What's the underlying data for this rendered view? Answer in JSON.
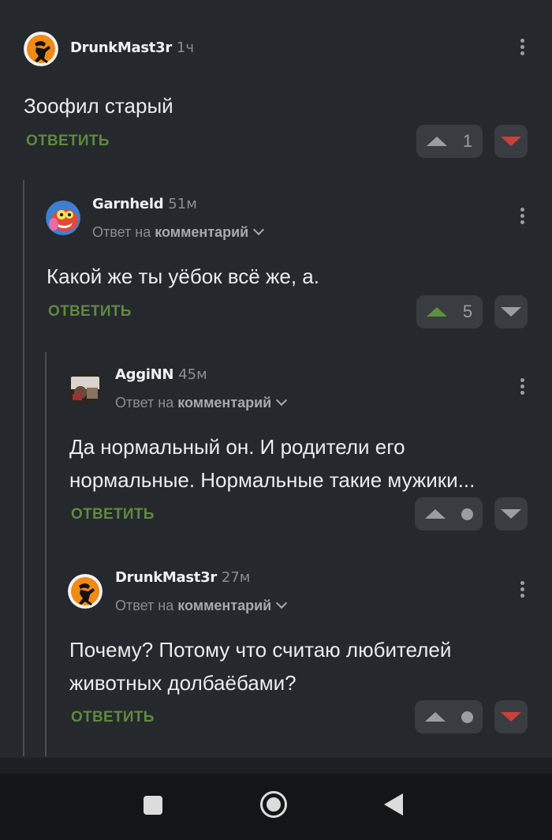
{
  "colors": {
    "background": "#25282c",
    "reply_green": "#5e8a3f",
    "upvote_active": "#5d8f3c",
    "downvote_active": "#c9403b",
    "vote_box": "#393c41"
  },
  "comments": [
    {
      "author": "DrunkMast3r",
      "time": "1ч",
      "reply_to": null,
      "text": [
        "Зоофил старый"
      ],
      "reply_label": "ОТВЕТИТЬ",
      "score": "1",
      "vote_state": "downvoted",
      "avatar_icon": "ninja-avatar-icon"
    },
    {
      "author": "Garnheld",
      "time": "51м",
      "reply_to": {
        "prefix": "Ответ на",
        "target": "комментарий"
      },
      "text": [
        "Какой же ты уёбок всё же, а."
      ],
      "reply_label": "ОТВЕТИТЬ",
      "score": "5",
      "vote_state": "upvoted",
      "avatar_icon": "cartoon-monster-avatar-icon"
    },
    {
      "author": "AggiNN",
      "time": "45м",
      "reply_to": {
        "prefix": "Ответ на",
        "target": "комментарий"
      },
      "text": [
        "Да нормальный он. И родители его",
        "нормальные. Нормальные такие мужики..."
      ],
      "reply_label": "ОТВЕТИТЬ",
      "score": null,
      "vote_state": "none",
      "avatar_icon": "photo-avatar-icon"
    },
    {
      "author": "DrunkMast3r",
      "time": "27м",
      "reply_to": {
        "prefix": "Ответ на",
        "target": "комментарий"
      },
      "text": [
        "Почему? Потому что считаю любителей",
        "животных долбаёбами?"
      ],
      "reply_label": "ОТВЕТИТЬ",
      "score": null,
      "vote_state": "downvoted",
      "avatar_icon": "ninja-avatar-icon"
    }
  ],
  "navbar": {
    "icons": [
      "recent-apps-icon",
      "home-icon",
      "back-icon"
    ]
  }
}
